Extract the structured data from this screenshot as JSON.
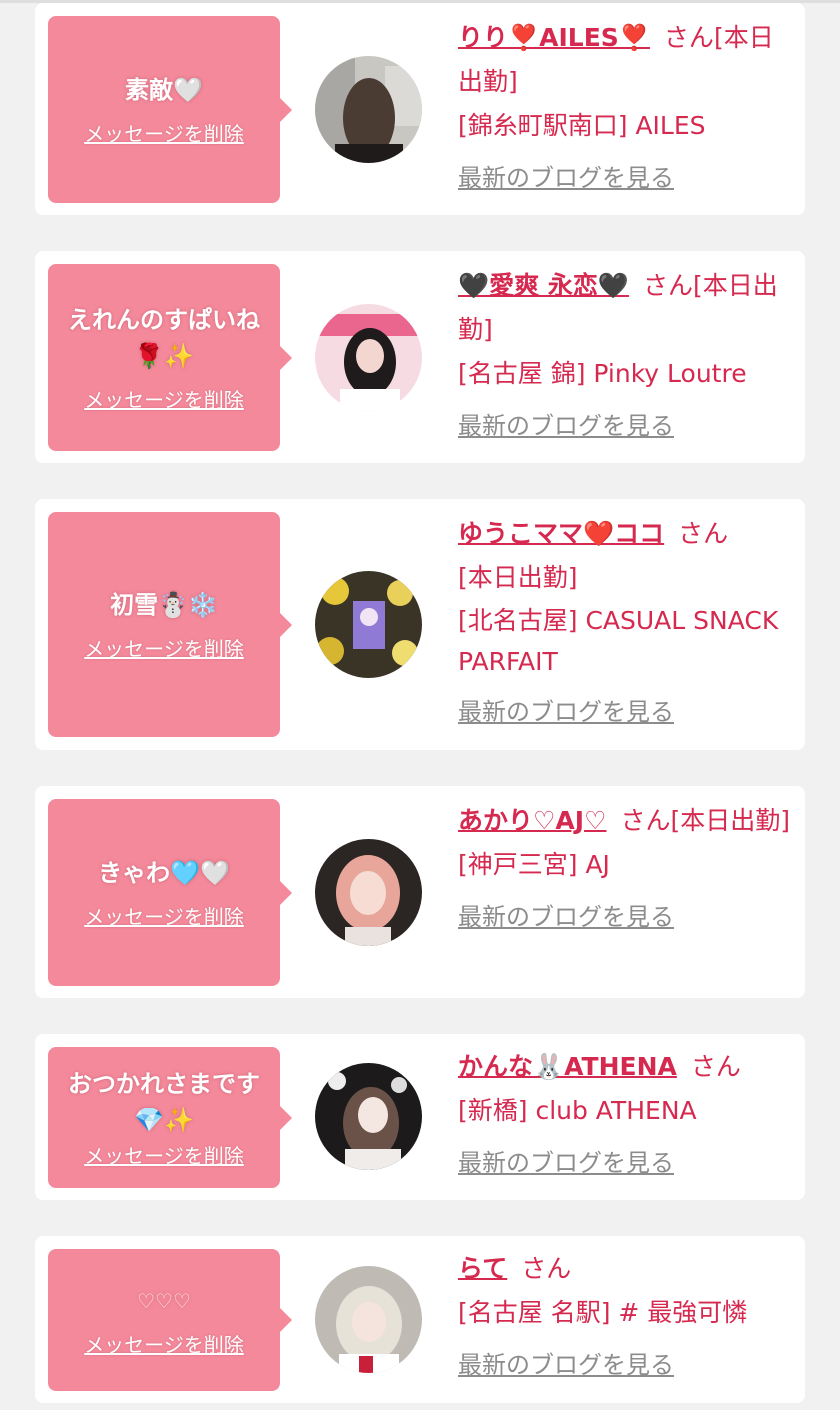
{
  "colors": {
    "accent": "#d6294f",
    "bubble": "#f3899a",
    "link_gray": "#8c8c8c",
    "background": "#f1f1f1"
  },
  "delete_label": "メッセージを削除",
  "blog_label": "最新のブログを見る",
  "san_label": "さん",
  "items": [
    {
      "message": "素敵🤍",
      "name": "りり❣️AILES❣️",
      "status": "[本日出勤]",
      "shop": "[錦糸町駅南口] AILES",
      "avatar": "woman-long-hair-back-photo"
    },
    {
      "message": "えれんのすぱいね🌹✨",
      "name": "🖤愛爽 永恋🖤",
      "status": "[本日出勤]",
      "shop": "[名古屋 錦] Pinky Loutre",
      "avatar": "woman-black-hair-pink-background-photo"
    },
    {
      "message": "初雪☃️❄️",
      "name": "ゆうこママ❤️ココ",
      "status": "[本日出勤]",
      "shop": "[北名古屋] CASUAL SNACK PARFAIT",
      "avatar": "flower-stand-photo"
    },
    {
      "message": "きゃわ🩵🤍",
      "name": "あかり♡AJ♡",
      "status": "[本日出勤]",
      "shop": "[神戸三宮] AJ",
      "avatar": "woman-pink-hair-photo"
    },
    {
      "message": "おつかれさまです💎✨",
      "name": "かんな🐰ATHENA",
      "status": "",
      "shop": "[新橋] club ATHENA",
      "avatar": "woman-dark-room-photo"
    },
    {
      "message": "♡♡♡",
      "name": "らて",
      "status": "",
      "shop": "[名古屋 名駅] # 最強可憐",
      "avatar": "woman-silver-hair-photo"
    }
  ]
}
